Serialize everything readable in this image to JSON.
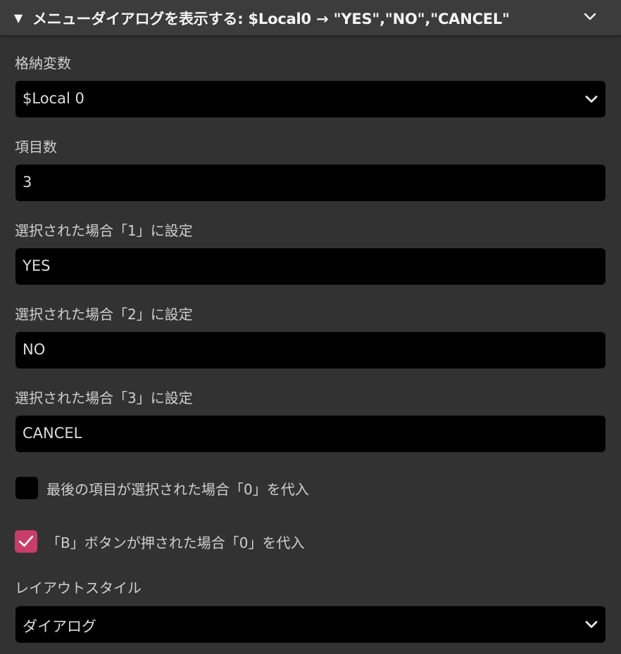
{
  "header": {
    "title": "メニューダイアログを表示する: $Local0 → \"YES\",\"NO\",\"CANCEL\"",
    "toggle_icon": "triangle-down-icon",
    "collapse_icon": "chevron-down-icon"
  },
  "fields": {
    "variable": {
      "label": "格納変数",
      "value": "$Local 0"
    },
    "item_count": {
      "label": "項目数",
      "value": "3"
    },
    "choice1": {
      "label": "選択された場合「1」に設定",
      "value": "YES"
    },
    "choice2": {
      "label": "選択された場合「2」に設定",
      "value": "NO"
    },
    "choice3": {
      "label": "選択された場合「3」に設定",
      "value": "CANCEL"
    },
    "layout": {
      "label": "レイアウトスタイル",
      "value": "ダイアログ"
    }
  },
  "checkboxes": {
    "last_item": {
      "label": "最後の項目が選択された場合「0」を代入",
      "checked": false
    },
    "b_button": {
      "label": "「B」ボタンが押された場合「0」を代入",
      "checked": true
    }
  },
  "colors": {
    "background": "#323232",
    "header": "#3c3c3c",
    "field": "#000000",
    "accent": "#c83d6a"
  }
}
